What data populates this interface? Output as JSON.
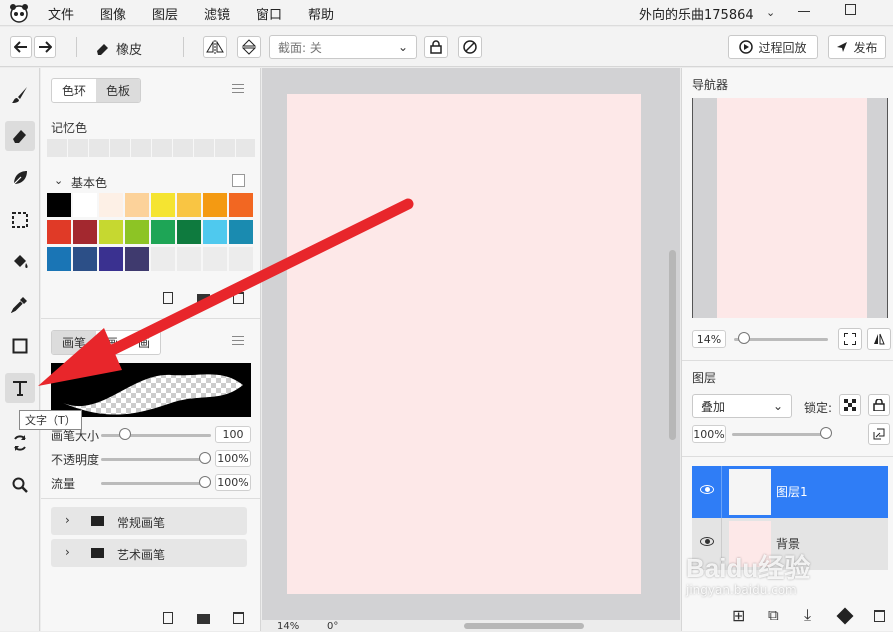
{
  "menubar": {
    "items": [
      "文件",
      "图像",
      "图层",
      "滤镜",
      "窗口",
      "帮助"
    ],
    "document_name": "外向的乐曲175864"
  },
  "toolbar": {
    "eraser_label": "橡皮",
    "truncate_label": "截面: 关",
    "replay_label": "过程回放",
    "publish_label": "发布"
  },
  "tooltip": "文字（T）",
  "color_panel": {
    "tabs": [
      "色环",
      "色板"
    ],
    "active_tab": "色板",
    "memory_label": "记忆色",
    "basic_label": "基本色",
    "swatches": [
      "#000000",
      "#ffffff",
      "#fdf0e6",
      "#fcd29a",
      "#f5e431",
      "#f9c543",
      "#f49a12",
      "#f26722",
      "#e03a27",
      "#a3282f",
      "#c6d830",
      "#8dc425",
      "#1ea556",
      "#0e7a3e",
      "#4fc9ee",
      "#1a8bb0",
      "#1a75b5",
      "#2c4f87",
      "#3a3190",
      "#3f3a6e",
      "#ececec",
      "#ececec",
      "#ececec",
      "#ececec"
    ]
  },
  "brush_panel": {
    "tabs": [
      "画笔",
      "画",
      "画"
    ],
    "size_label": "画笔大小",
    "size_value": "100",
    "opacity_label": "不透明度",
    "opacity_value": "100%",
    "flow_label": "流量",
    "flow_value": "100%",
    "groups": [
      "常规画笔",
      "艺术画笔"
    ]
  },
  "status": {
    "zoom": "14%",
    "rotation": "0°"
  },
  "navigator": {
    "title": "导航器",
    "zoom": "14%"
  },
  "layers": {
    "title": "图层",
    "blend_mode": "叠加",
    "lock_label": "锁定:",
    "opacity": "100%",
    "items": [
      {
        "name": "图层1",
        "selected": true
      },
      {
        "name": "背景",
        "selected": false
      }
    ]
  },
  "watermark": {
    "brand": "Baidu经验",
    "url": "jingyan.baidu.com"
  },
  "colors": {
    "accent": "#2f7df6",
    "canvas": "#fde8e8",
    "arrow": "#e8262b"
  }
}
